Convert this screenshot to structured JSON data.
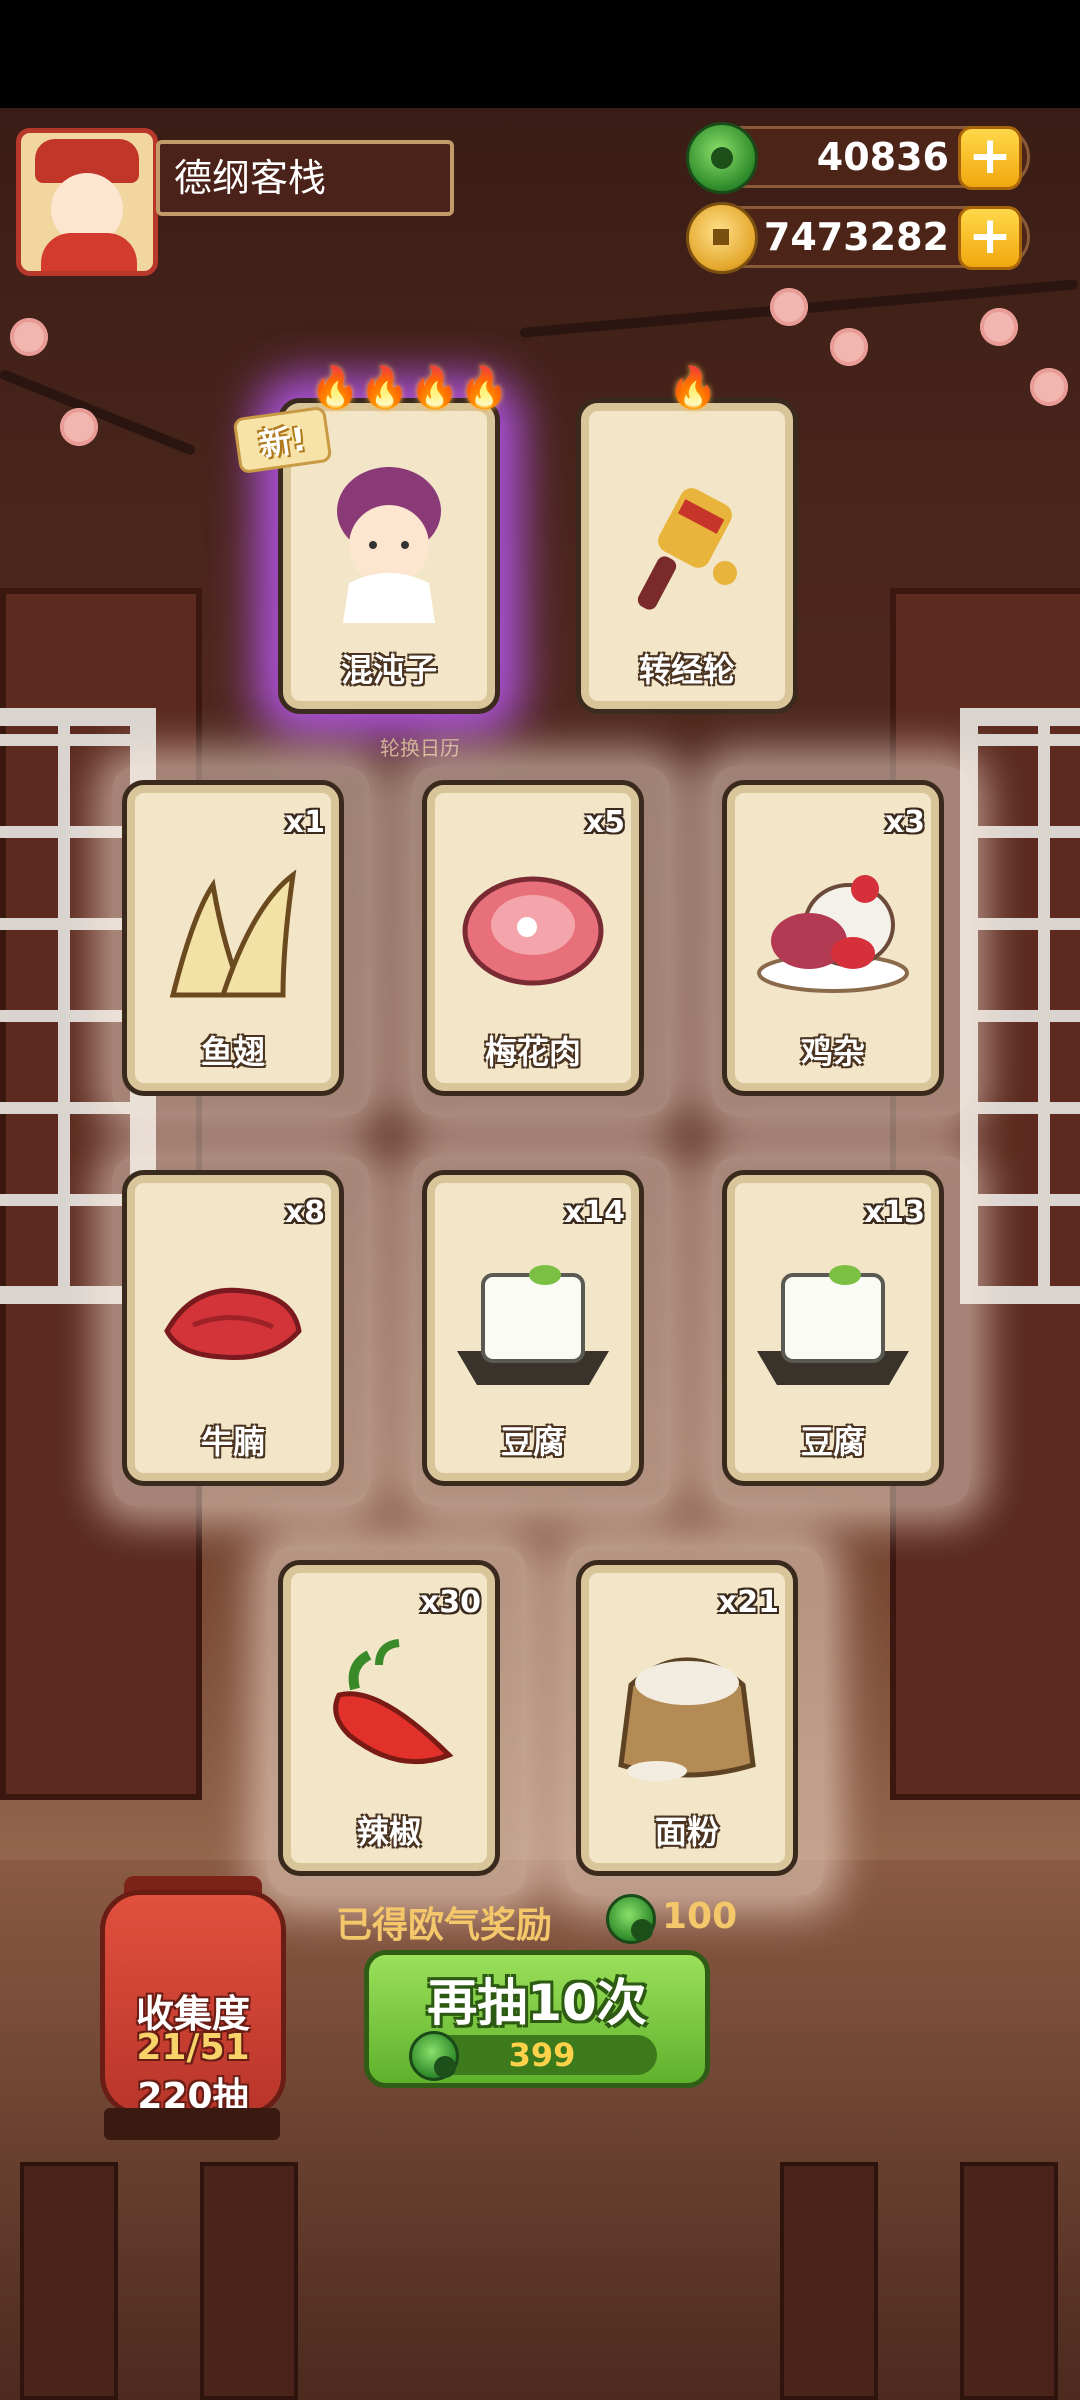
{
  "player": {
    "inn_name": "德纲客栈"
  },
  "currencies": [
    {
      "name": "jade",
      "value": "40836"
    },
    {
      "name": "coin",
      "value": "7473282"
    }
  ],
  "badges": {
    "new": "新!"
  },
  "faint_label": "轮换日历",
  "cards": [
    {
      "name": "混沌子",
      "qty": "",
      "rarity_flames": 4,
      "is_new": true,
      "highlight": "#b85cff",
      "icon": "girl-character-icon"
    },
    {
      "name": "转经轮",
      "qty": "",
      "rarity_flames": 1,
      "is_new": false,
      "icon": "prayer-wheel-icon"
    },
    {
      "name": "鱼翅",
      "qty": "x1",
      "icon": "shark-fin-icon"
    },
    {
      "name": "梅花肉",
      "qty": "x5",
      "icon": "pork-meat-icon"
    },
    {
      "name": "鸡杂",
      "qty": "x3",
      "icon": "chicken-giblets-icon"
    },
    {
      "name": "牛腩",
      "qty": "x8",
      "icon": "beef-brisket-icon"
    },
    {
      "name": "豆腐",
      "qty": "x14",
      "icon": "tofu-icon"
    },
    {
      "name": "豆腐",
      "qty": "x13",
      "icon": "tofu-icon"
    },
    {
      "name": "辣椒",
      "qty": "x30",
      "icon": "chili-pepper-icon"
    },
    {
      "name": "面粉",
      "qty": "x21",
      "icon": "flour-sack-icon"
    }
  ],
  "reward": {
    "label": "已得欧气奖励",
    "amount": "100"
  },
  "draw_button": {
    "label": "再抽10次",
    "cost": "399"
  },
  "collection": {
    "title": "收集度",
    "progress": "21/51",
    "draws": "220抽"
  },
  "colors": {
    "accent_green": "#5fb12c",
    "gold": "#f1a70d",
    "new_glow": "#b85cff"
  }
}
